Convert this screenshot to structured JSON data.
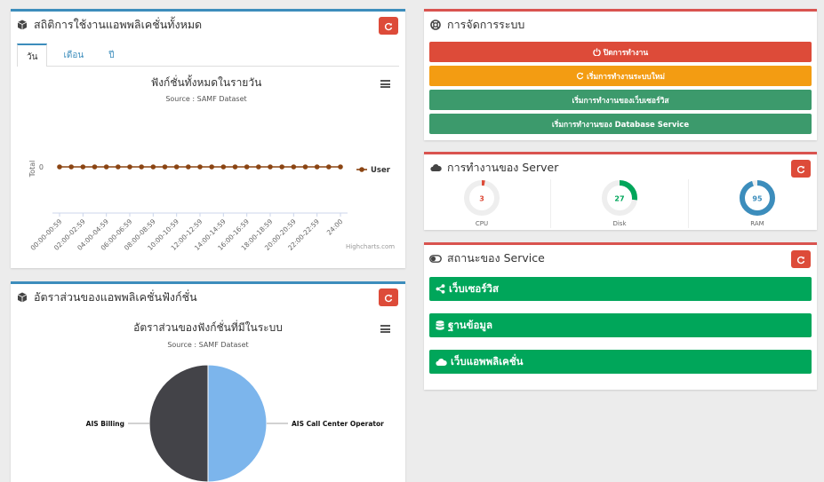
{
  "app_stats": {
    "title": "สถิติการใช้งานแอพพลิเคชั่นทั้งหมด",
    "tabs": [
      {
        "label": "วัน",
        "active": true
      },
      {
        "label": "เดือน",
        "active": false
      },
      {
        "label": "ปี",
        "active": false
      }
    ],
    "chart_title": "ฟังก์ชั่นทั้งหมดในรายวัน",
    "chart_source": "Source : SAMF Dataset",
    "credit": "Highcharts.com"
  },
  "function_ratio": {
    "title": "อัตราส่วนของแอพพลิเคชั่นฟังก์ชั่น",
    "chart_title": "อัตราส่วนของฟังก์ชั่นที่มีในระบบ",
    "chart_source": "Source : SAMF Dataset"
  },
  "system_mgmt": {
    "title": "การจัดการระบบ",
    "buttons": [
      {
        "label": "ปิดการทำงาน",
        "color": "#dd4b39",
        "icon": "power-icon"
      },
      {
        "label": "เริ่มการทำงานระบบใหม่",
        "color": "#f39c12",
        "icon": "refresh-icon"
      },
      {
        "label": "เริ่มการทำงานของเว็บเซอร์วิส",
        "color": "#3c9a6c",
        "icon": ""
      },
      {
        "label": "เริ่มการทำงานของ Database Service",
        "color": "#3c9a6c",
        "icon": ""
      }
    ]
  },
  "server_status": {
    "title": "การทำงานของ Server",
    "gauges": [
      {
        "label": "CPU",
        "value": 3,
        "color": "#dd4b39"
      },
      {
        "label": "Disk",
        "value": 27,
        "color": "#00a65a"
      },
      {
        "label": "RAM",
        "value": 95,
        "color": "#3c8dbc"
      }
    ]
  },
  "service_status": {
    "title": "สถานะของ Service",
    "items": [
      {
        "label": "เว็บเซอร์วิส",
        "icon": "share-icon"
      },
      {
        "label": "ฐานข้อมูล",
        "icon": "database-icon"
      },
      {
        "label": "เว็บแอพพลิเคชั่น",
        "icon": "cloud-icon"
      }
    ]
  },
  "chart_data": [
    {
      "type": "line",
      "title": "ฟังก์ชั่นทั้งหมดในรายวัน",
      "subtitle": "Source : SAMF Dataset",
      "xlabel": "",
      "ylabel": "Total",
      "categories": [
        "00:00-00:59",
        "01:00-01:59",
        "02:00-02:59",
        "03:00-03:59",
        "04:00-04:59",
        "05:00-05:59",
        "06:00-06:59",
        "07:00-07:59",
        "08:00-08:59",
        "09:00-09:59",
        "10:00-10:59",
        "11:00-11:59",
        "12:00-12:59",
        "13:00-13:59",
        "14:00-14:59",
        "15:00-15:59",
        "16:00-16:59",
        "17:00-17:59",
        "18:00-18:59",
        "19:00-19:59",
        "20:00-20:59",
        "21:00-21:59",
        "22:00-22:59",
        "23:00-23:59",
        "24:00"
      ],
      "series": [
        {
          "name": "User",
          "values": [
            0,
            0,
            0,
            0,
            0,
            0,
            0,
            0,
            0,
            0,
            0,
            0,
            0,
            0,
            0,
            0,
            0,
            0,
            0,
            0,
            0,
            0,
            0,
            0,
            0
          ],
          "color": "#8b4513"
        }
      ],
      "yticks": [
        0
      ],
      "legend": "right",
      "grid": false
    },
    {
      "type": "pie",
      "title": "อัตราส่วนของฟังก์ชั่นที่มีในระบบ",
      "subtitle": "Source : SAMF Dataset",
      "slices": [
        {
          "name": "AIS Call Center Operator",
          "value": 50,
          "color": "#7cb5ec"
        },
        {
          "name": "AIS Billing",
          "value": 50,
          "color": "#434348"
        }
      ]
    }
  ]
}
